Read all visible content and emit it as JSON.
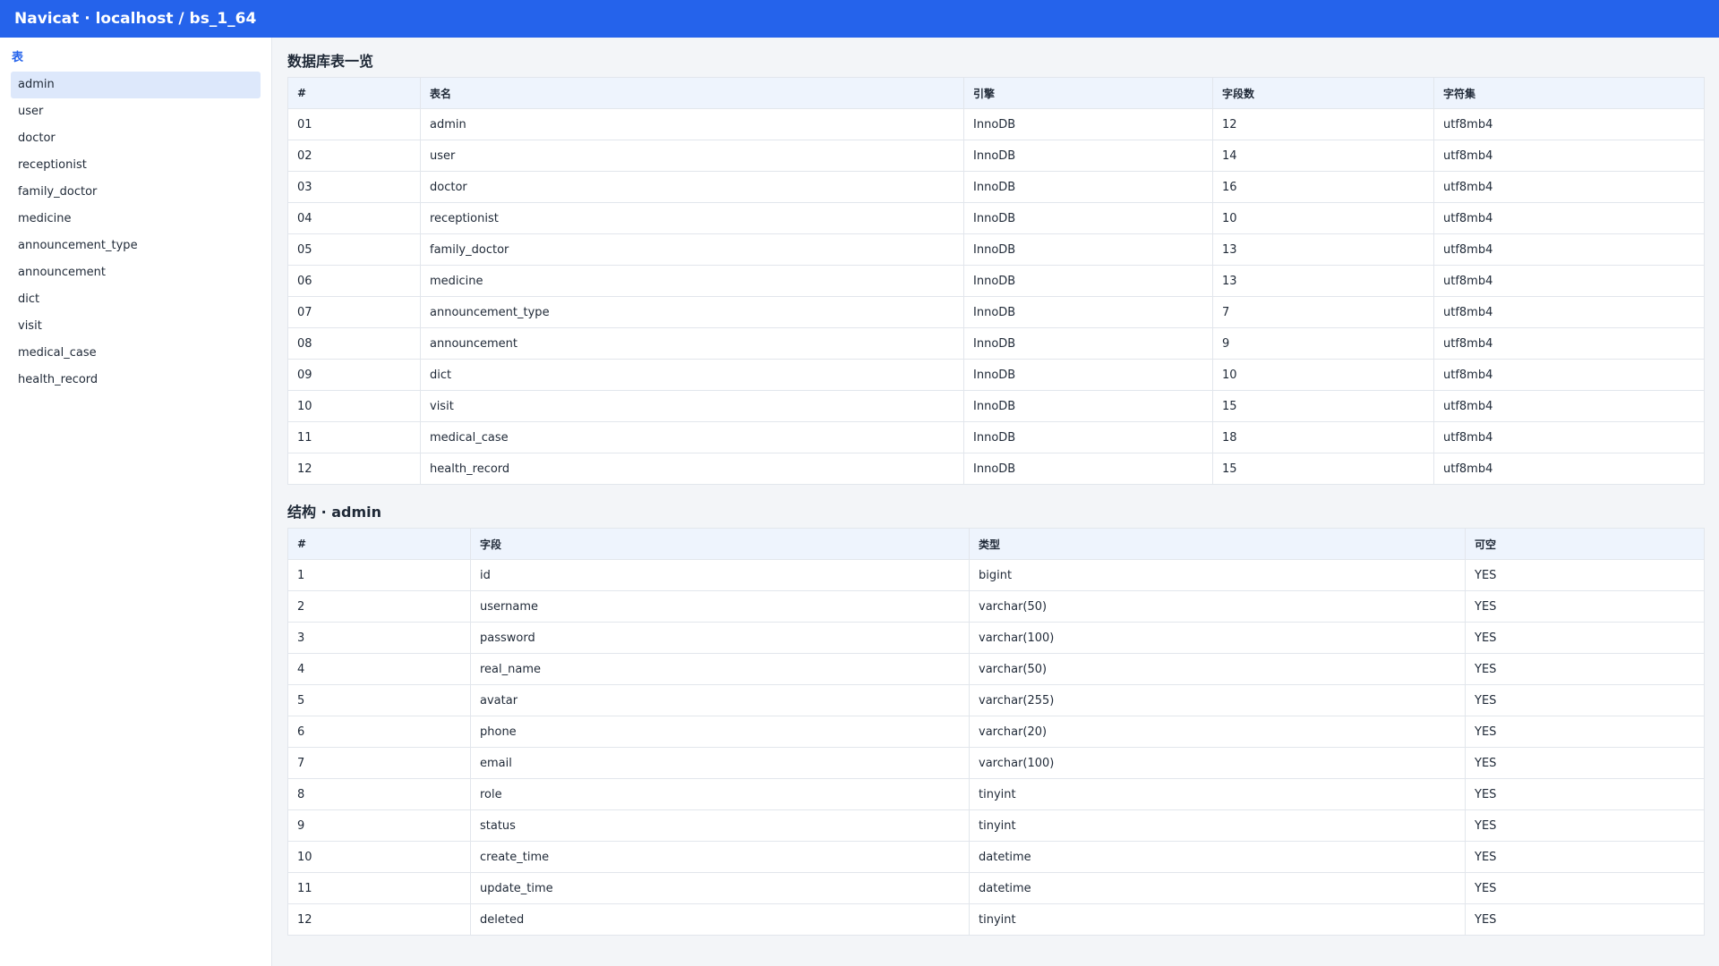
{
  "window": {
    "title": "Navicat · localhost / bs_1_64"
  },
  "sidebar": {
    "heading": "表",
    "active_index": 0,
    "items": [
      {
        "label": "admin"
      },
      {
        "label": "user"
      },
      {
        "label": "doctor"
      },
      {
        "label": "receptionist"
      },
      {
        "label": "family_doctor"
      },
      {
        "label": "medicine"
      },
      {
        "label": "announcement_type"
      },
      {
        "label": "announcement"
      },
      {
        "label": "dict"
      },
      {
        "label": "visit"
      },
      {
        "label": "medical_case"
      },
      {
        "label": "health_record"
      }
    ]
  },
  "tables_overview": {
    "title": "数据库表一览",
    "columns": [
      "#",
      "表名",
      "引擎",
      "字段数",
      "字符集"
    ],
    "rows": [
      [
        "01",
        "admin",
        "InnoDB",
        "12",
        "utf8mb4"
      ],
      [
        "02",
        "user",
        "InnoDB",
        "14",
        "utf8mb4"
      ],
      [
        "03",
        "doctor",
        "InnoDB",
        "16",
        "utf8mb4"
      ],
      [
        "04",
        "receptionist",
        "InnoDB",
        "10",
        "utf8mb4"
      ],
      [
        "05",
        "family_doctor",
        "InnoDB",
        "13",
        "utf8mb4"
      ],
      [
        "06",
        "medicine",
        "InnoDB",
        "13",
        "utf8mb4"
      ],
      [
        "07",
        "announcement_type",
        "InnoDB",
        "7",
        "utf8mb4"
      ],
      [
        "08",
        "announcement",
        "InnoDB",
        "9",
        "utf8mb4"
      ],
      [
        "09",
        "dict",
        "InnoDB",
        "10",
        "utf8mb4"
      ],
      [
        "10",
        "visit",
        "InnoDB",
        "15",
        "utf8mb4"
      ],
      [
        "11",
        "medical_case",
        "InnoDB",
        "18",
        "utf8mb4"
      ],
      [
        "12",
        "health_record",
        "InnoDB",
        "15",
        "utf8mb4"
      ]
    ]
  },
  "structure": {
    "title": "结构 · admin",
    "columns": [
      "#",
      "字段",
      "类型",
      "可空"
    ],
    "rows": [
      [
        "1",
        "id",
        "bigint",
        "YES"
      ],
      [
        "2",
        "username",
        "varchar(50)",
        "YES"
      ],
      [
        "3",
        "password",
        "varchar(100)",
        "YES"
      ],
      [
        "4",
        "real_name",
        "varchar(50)",
        "YES"
      ],
      [
        "5",
        "avatar",
        "varchar(255)",
        "YES"
      ],
      [
        "6",
        "phone",
        "varchar(20)",
        "YES"
      ],
      [
        "7",
        "email",
        "varchar(100)",
        "YES"
      ],
      [
        "8",
        "role",
        "tinyint",
        "YES"
      ],
      [
        "9",
        "status",
        "tinyint",
        "YES"
      ],
      [
        "10",
        "create_time",
        "datetime",
        "YES"
      ],
      [
        "11",
        "update_time",
        "datetime",
        "YES"
      ],
      [
        "12",
        "deleted",
        "tinyint",
        "YES"
      ]
    ]
  },
  "colors": {
    "accent": "#2563eb",
    "active_item": "#dde8fb",
    "header_bg": "#eef4fd"
  }
}
